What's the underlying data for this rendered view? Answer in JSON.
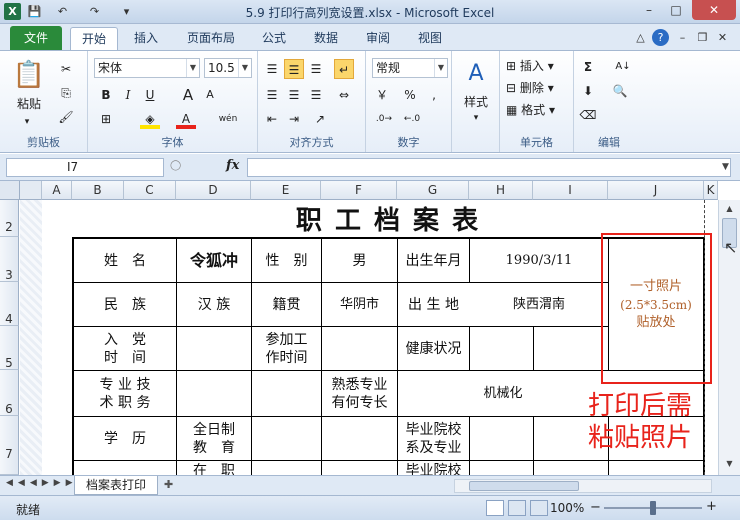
{
  "window": {
    "title": "5.9 打印行高列宽设置.xlsx - Microsoft Excel",
    "min": "–",
    "max": "□",
    "close": "✕"
  },
  "quick_access": {
    "save": "💾",
    "undo": "↶",
    "redo": "↷"
  },
  "tabs": {
    "file": "文件",
    "items": [
      "开始",
      "插入",
      "页面布局",
      "公式",
      "数据",
      "审阅",
      "视图"
    ]
  },
  "ribbon": {
    "paste": "粘贴",
    "clipboard": "剪贴板",
    "font_group": "字体",
    "align_group": "对齐方式",
    "number_group": "数字",
    "style_label": "样式",
    "cells_group": "单元格",
    "edit_group": "编辑",
    "font_name": "宋体",
    "font_size": "10.5",
    "number_format": "常规",
    "insert": "插入",
    "delete": "删除",
    "format": "格式",
    "bold": "B",
    "italic": "I",
    "underline": "U",
    "grow": "A",
    "shrink": "A",
    "wen": "wén",
    "percent": "%",
    "comma": ",",
    "currency": "￥",
    "sigma": "Σ",
    "sort": "A↓"
  },
  "formula_bar": {
    "name_box": "I7",
    "fx": "fx",
    "value": ""
  },
  "columns": [
    "A",
    "B",
    "C",
    "D",
    "E",
    "F",
    "G",
    "H",
    "I",
    "J",
    "K"
  ],
  "rows": [
    "2",
    "3",
    "4",
    "5",
    "6",
    "7"
  ],
  "sheet": {
    "title": "职 工 档 案 表",
    "name_label": "姓　名",
    "name_value": "令狐冲",
    "gender_label": "性　别",
    "gender_value": "男",
    "birth_label": "出生年月",
    "birth_value": "1990/3/11",
    "photo_text": [
      "一寸照片",
      "(2.5*3.5cm)",
      "贴放处"
    ],
    "ethnic_label": "民　族",
    "ethnic_value": "汉 族",
    "origin_label": "籍贯",
    "origin_value": "华阴市",
    "birthplace_label": "出 生 地",
    "birthplace_value": "陕西渭南",
    "party_label": [
      "入　党",
      "时　间"
    ],
    "work_label": [
      "参加工",
      "作时间"
    ],
    "health_label": "健康状况",
    "title_label": [
      "专 业 技",
      "术 职 务"
    ],
    "skill_label": [
      "熟悉专业",
      "有何专长"
    ],
    "skill_value": "机械化",
    "edu_label": "学　历",
    "fulltime_label": [
      "全日制",
      "教　育"
    ],
    "school_label": [
      "毕业院校",
      "系及专业"
    ],
    "inservice_label": "在　职",
    "school2_label": "毕业院校",
    "annotation": [
      "打印后需",
      "粘贴照片"
    ]
  },
  "sheet_tabs": {
    "active": "档案表打印"
  },
  "status": {
    "ready": "就绪",
    "zoom": "100%",
    "minus": "−",
    "plus": "+"
  },
  "colors": {
    "annotation": "#e8231b",
    "photo_text": "#b0602a",
    "highlight_box": "#e8231b"
  }
}
